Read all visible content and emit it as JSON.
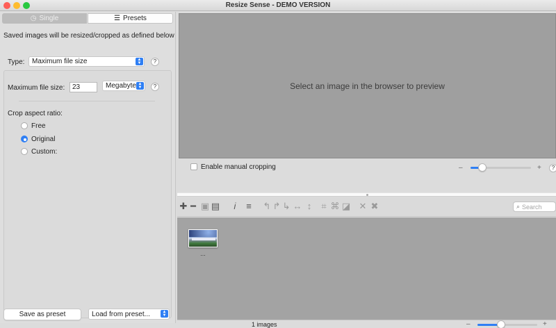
{
  "window": {
    "title": "Resize Sense - DEMO VERSION",
    "traffic_lights": {
      "close": "#fe5f57",
      "minimize": "#febc2e",
      "zoom": "#28c840"
    }
  },
  "mode_tabs": [
    {
      "label": "Single",
      "icon": "clock-icon",
      "selected": false
    },
    {
      "label": "Presets",
      "icon": "list-icon",
      "selected": true
    }
  ],
  "left_panel": {
    "info": "Saved images will be resized/cropped as defined below",
    "type_label": "Type:",
    "type_value": "Maximum file size",
    "help": "?",
    "max_size_label": "Maximum file size:",
    "max_size_value": "23",
    "unit_value": "Megabyte",
    "crop_label": "Crop aspect ratio:",
    "crop_options": [
      {
        "label": "Free",
        "selected": false
      },
      {
        "label": "Original",
        "selected": true
      },
      {
        "label": "Custom:",
        "selected": false
      }
    ],
    "save_preset": "Save as preset",
    "load_preset": "Load from preset..."
  },
  "preview": {
    "message": "Select an image in the browser to preview",
    "manual_crop_label": "Enable manual cropping",
    "manual_crop_checked": false,
    "zoom_minus": "–",
    "zoom_plus": "+",
    "zoom_level": 0.2,
    "help": "?"
  },
  "toolbar": {
    "search_placeholder": "Search",
    "tools": [
      {
        "name": "add-icon",
        "glyph": "✚",
        "enabled": true
      },
      {
        "name": "remove-icon",
        "glyph": "━",
        "enabled": true
      },
      {
        "name": "save-icon",
        "glyph": "▣",
        "enabled": false
      },
      {
        "name": "save-all-icon",
        "glyph": "▤",
        "enabled": true
      },
      {
        "name": "info-icon",
        "glyph": "𝑖",
        "enabled": true
      },
      {
        "name": "menu-icon",
        "glyph": "≡",
        "enabled": true
      },
      {
        "name": "rotate-left-icon",
        "glyph": "↰",
        "enabled": false
      },
      {
        "name": "rotate-right-icon",
        "glyph": "↱",
        "enabled": false
      },
      {
        "name": "rotate-icon",
        "glyph": "↳",
        "enabled": false
      },
      {
        "name": "flip-horizontal-icon",
        "glyph": "↔",
        "enabled": false
      },
      {
        "name": "flip-vertical-icon",
        "glyph": "↕",
        "enabled": false
      },
      {
        "name": "crop-icon",
        "glyph": "⌗",
        "enabled": false
      },
      {
        "name": "crop-multi-icon",
        "glyph": "⌘",
        "enabled": false
      },
      {
        "name": "straighten-icon",
        "glyph": "◪",
        "enabled": false
      },
      {
        "name": "cancel-icon",
        "glyph": "✕",
        "enabled": false
      },
      {
        "name": "cancel-all-icon",
        "glyph": "✖",
        "enabled": false
      }
    ]
  },
  "browser": {
    "thumbnail_caption": "...",
    "status": "1 images",
    "zoom_minus": "–",
    "zoom_plus": "+",
    "zoom_level": 0.4
  }
}
